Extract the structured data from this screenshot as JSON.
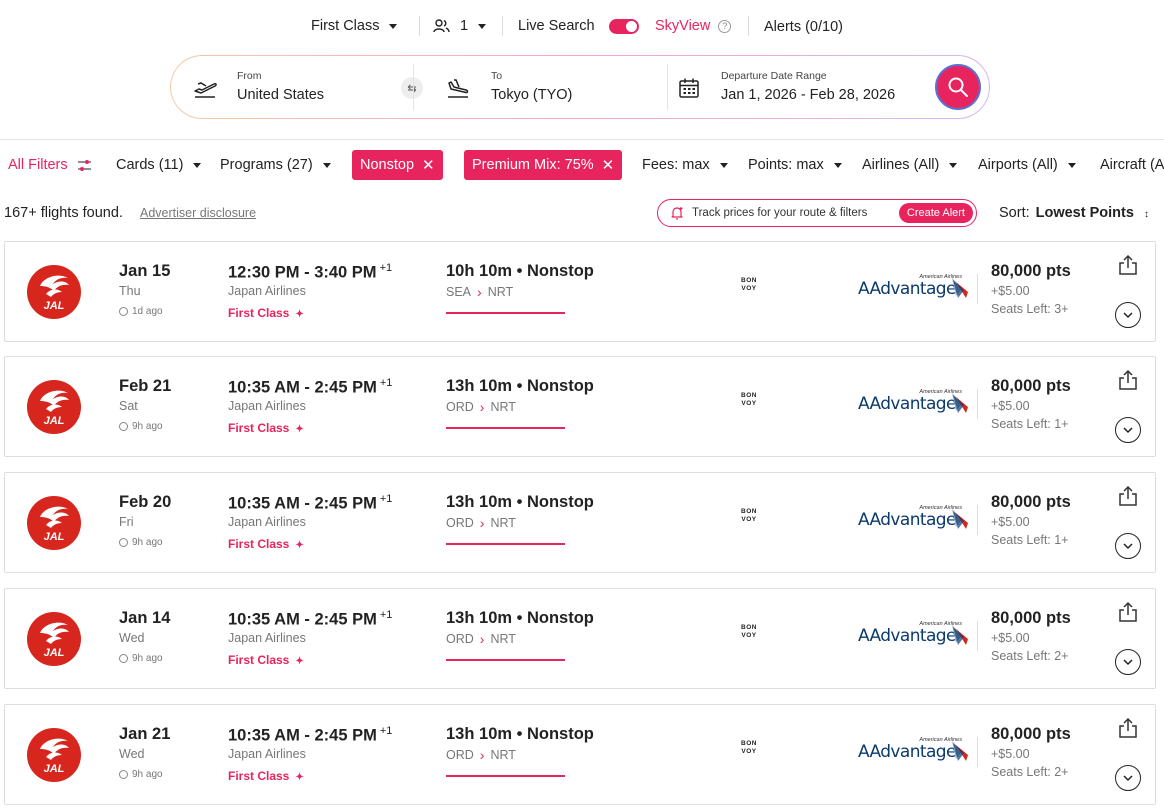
{
  "topbar": {
    "cabin": "First Class",
    "passengers": "1",
    "live_search": "Live Search",
    "skyview": "SkyView",
    "alerts": "Alerts (0/10)"
  },
  "search": {
    "from_label": "From",
    "from_value": "United States",
    "to_label": "To",
    "to_value": "Tokyo (TYO)",
    "date_label": "Departure Date Range",
    "date_value": "Jan 1, 2026 - Feb 28, 2026"
  },
  "filters": {
    "all_filters": "All Filters",
    "cards": "Cards (11)",
    "programs": "Programs (27)",
    "nonstop": "Nonstop",
    "premium_mix": "Premium Mix: 75%",
    "fees": "Fees: max",
    "points": "Points: max",
    "airlines": "Airlines (All)",
    "airports": "Airports (All)",
    "aircraft": "Aircraft (A"
  },
  "results": {
    "found": "167+ flights found.",
    "disclosure": "Advertiser disclosure",
    "track_text": "Track prices for your route & filters",
    "create_alert": "Create Alert",
    "sort_label": "Sort:",
    "sort_value": "Lowest Points"
  },
  "flights": [
    {
      "date": "Jan 15",
      "dow": "Thu",
      "ago": "1d ago",
      "time": "12:30 PM - 3:40 PM",
      "day_offset": "+1",
      "airline": "Japan Airlines",
      "cabin": "First Class",
      "duration": "10h 10m • Nonstop",
      "origin": "SEA",
      "dest": "NRT",
      "points": "80,000 pts",
      "fee": "+$5.00",
      "seats": "Seats Left: 3+"
    },
    {
      "date": "Feb 21",
      "dow": "Sat",
      "ago": "9h ago",
      "time": "10:35 AM - 2:45 PM",
      "day_offset": "+1",
      "airline": "Japan Airlines",
      "cabin": "First Class",
      "duration": "13h 10m • Nonstop",
      "origin": "ORD",
      "dest": "NRT",
      "points": "80,000 pts",
      "fee": "+$5.00",
      "seats": "Seats Left: 1+"
    },
    {
      "date": "Feb 20",
      "dow": "Fri",
      "ago": "9h ago",
      "time": "10:35 AM - 2:45 PM",
      "day_offset": "+1",
      "airline": "Japan Airlines",
      "cabin": "First Class",
      "duration": "13h 10m • Nonstop",
      "origin": "ORD",
      "dest": "NRT",
      "points": "80,000 pts",
      "fee": "+$5.00",
      "seats": "Seats Left: 1+"
    },
    {
      "date": "Jan 14",
      "dow": "Wed",
      "ago": "9h ago",
      "time": "10:35 AM - 2:45 PM",
      "day_offset": "+1",
      "airline": "Japan Airlines",
      "cabin": "First Class",
      "duration": "13h 10m • Nonstop",
      "origin": "ORD",
      "dest": "NRT",
      "points": "80,000 pts",
      "fee": "+$5.00",
      "seats": "Seats Left: 2+"
    },
    {
      "date": "Jan 21",
      "dow": "Wed",
      "ago": "9h ago",
      "time": "10:35 AM - 2:45 PM",
      "day_offset": "+1",
      "airline": "Japan Airlines",
      "cabin": "First Class",
      "duration": "13h 10m • Nonstop",
      "origin": "ORD",
      "dest": "NRT",
      "points": "80,000 pts",
      "fee": "+$5.00",
      "seats": "Seats Left: 2+"
    }
  ],
  "brand": {
    "bonvoy_top": "BON",
    "bonvoy_bottom": "VOY",
    "aa_small": "American Airlines",
    "aa_big": "AAdvantage",
    "jal": "JAL"
  },
  "icons": {
    "passengers": "people-icon",
    "departure": "plane-takeoff-icon",
    "arrival": "plane-landing-icon",
    "calendar": "calendar-icon",
    "search": "search-icon",
    "swap": "swap-icon",
    "filters": "sliders-icon",
    "bell": "bell-plus-icon",
    "share": "share-icon",
    "expand": "chevron-down-icon",
    "clock": "clock-icon",
    "sparkle": "sparkle-icon"
  },
  "colors": {
    "accent": "#e8245e",
    "jal_red": "#d7261e",
    "aa_blue": "#0a3a6e"
  }
}
